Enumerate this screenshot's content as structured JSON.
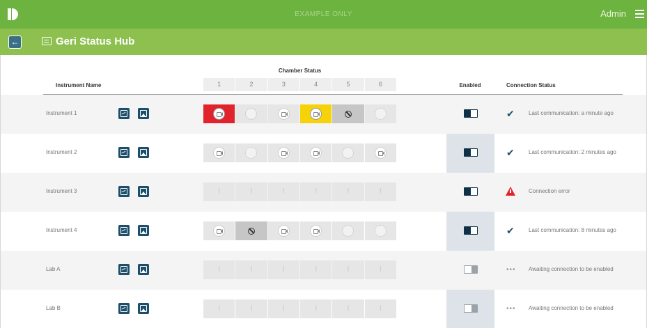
{
  "topbar": {
    "watermark": "EXAMPLE ONLY",
    "user": "Admin"
  },
  "subbar": {
    "title": "Geri Status Hub"
  },
  "table": {
    "instrument_header": "Instrument Name",
    "chamber_header": "Chamber Status",
    "chamber_numbers": [
      "1",
      "2",
      "3",
      "4",
      "5",
      "6"
    ],
    "enabled_header": "Enabled",
    "connection_header": "Connection Status",
    "rows": [
      {
        "name": "Instrument 1",
        "enabled": true,
        "status_icon": "check-icon",
        "status": "Last communication: a minute ago",
        "chambers": [
          "red-camera",
          "empty",
          "camera",
          "yellow-camera",
          "blocked",
          "dotted"
        ]
      },
      {
        "name": "Instrument 2",
        "enabled": true,
        "status_icon": "check-icon",
        "status": "Last communication: 2 minutes ago",
        "chambers": [
          "camera",
          "dotted",
          "camera",
          "camera",
          "empty",
          "camera"
        ]
      },
      {
        "name": "Instrument 3",
        "enabled": true,
        "status_icon": "warning-icon",
        "status": "Connection error",
        "chambers": [
          "exclaim",
          "exclaim",
          "exclaim",
          "exclaim",
          "exclaim",
          "exclaim"
        ]
      },
      {
        "name": "Instrument 4",
        "enabled": true,
        "status_icon": "check-icon",
        "status": "Last communication: 8 minutes ago",
        "chambers": [
          "camera",
          "blocked",
          "camera",
          "camera",
          "empty",
          "dotted"
        ]
      },
      {
        "name": "Lab A",
        "enabled": false,
        "status_icon": "dots-icon",
        "status": "Awaiting connection to be enabled",
        "chambers": [
          "exclaim",
          "exclaim",
          "exclaim",
          "exclaim",
          "exclaim",
          "exclaim"
        ]
      },
      {
        "name": "Lab B",
        "enabled": false,
        "status_icon": "dots-icon",
        "status": "Awaiting connection to be enabled",
        "chambers": [
          "exclaim",
          "exclaim",
          "exclaim",
          "exclaim",
          "exclaim",
          "exclaim"
        ]
      }
    ]
  },
  "colors": {
    "topbar": "#6db33f",
    "subbar": "#8dc04f",
    "navy": "#1d4f6b",
    "alert_red": "#e1242b",
    "warning_yellow": "#f6d20a"
  }
}
